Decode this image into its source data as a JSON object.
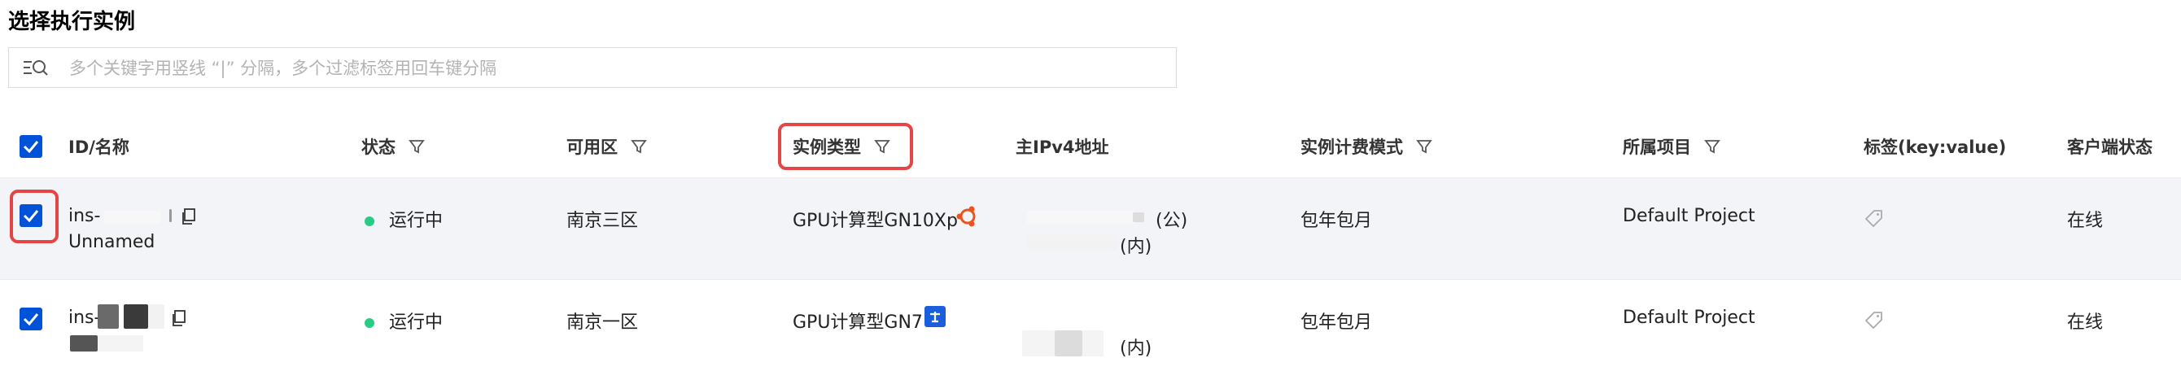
{
  "title": "选择执行实例",
  "search": {
    "placeholder": "多个关键字用竖线 “|” 分隔，多个过滤标签用回车键分隔",
    "value": ""
  },
  "columns": {
    "id_name": "ID/名称",
    "status": "状态",
    "zone": "可用区",
    "instance_type": "实例类型",
    "ipv4": "主IPv4地址",
    "billing": "实例计费模式",
    "project": "所属项目",
    "tags": "标签(key:value)",
    "client_status": "客户端状态"
  },
  "rows": [
    {
      "checked": true,
      "id_prefix": "ins-",
      "name": "Unnamed",
      "status": "运行中",
      "zone": "南京三区",
      "instance_type": "GPU计算型GN10Xp",
      "os_icon": "ubuntu-icon",
      "ip_public_suffix": "(公)",
      "ip_private_suffix": "(内)",
      "billing": "包年包月",
      "project": "Default Project",
      "client_status": "在线"
    },
    {
      "checked": true,
      "id_prefix": "ins-",
      "name": "",
      "status": "运行中",
      "zone": "南京一区",
      "instance_type": "GPU计算型GN7",
      "os_icon": "tencentos-icon",
      "ip_private_suffix": "(内)",
      "billing": "包年包月",
      "project": "Default Project",
      "client_status": "在线"
    }
  ],
  "colors": {
    "accent": "#0052d9",
    "highlight": "#e54545",
    "running": "#29cc85",
    "row_selected_bg": "#f3f4f7",
    "ubuntu": "#e95420"
  }
}
